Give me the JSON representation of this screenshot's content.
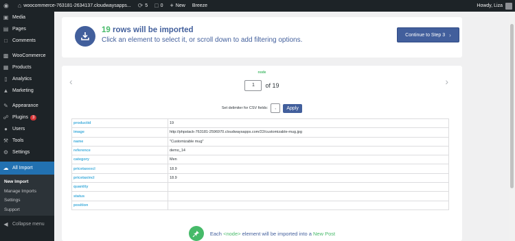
{
  "admin_bar": {
    "site_name": "woocommerce-763181-2634137.cloudwaysapps...",
    "updates_count": "5",
    "comments_count": "0",
    "new_label": "New",
    "breeze_label": "Breeze",
    "howdy_text": "Howdy, Liza"
  },
  "sidebar": {
    "items": [
      {
        "label": "Media",
        "icon": "media-icon"
      },
      {
        "label": "Pages",
        "icon": "pages-icon"
      },
      {
        "label": "Comments",
        "icon": "comments-icon"
      },
      {
        "label": "WooCommerce",
        "icon": "woocommerce-icon"
      },
      {
        "label": "Products",
        "icon": "products-icon"
      },
      {
        "label": "Analytics",
        "icon": "analytics-icon"
      },
      {
        "label": "Marketing",
        "icon": "marketing-icon"
      },
      {
        "label": "Appearance",
        "icon": "appearance-icon"
      },
      {
        "label": "Plugins",
        "icon": "plugins-icon",
        "badge": "3"
      },
      {
        "label": "Users",
        "icon": "users-icon"
      },
      {
        "label": "Tools",
        "icon": "tools-icon"
      },
      {
        "label": "Settings",
        "icon": "settings-icon"
      },
      {
        "label": "All Import",
        "icon": "all-import-icon"
      }
    ],
    "submenu": [
      "New Import",
      "Manage Imports",
      "Settings",
      "Support"
    ],
    "collapse_label": "Collapse menu"
  },
  "top_panel": {
    "rows_count": "19",
    "rows_text": "rows will be imported",
    "subtitle": "Click an element to select it, or scroll down to add filtering options.",
    "continue_label": "Continue to Step 3"
  },
  "main_panel": {
    "node_title": "node",
    "page_value": "1",
    "page_total": "of 19",
    "delimiter_label": "Set delimiter for CSV fields:",
    "delimiter_value": ",",
    "apply_label": "Apply",
    "rows": [
      {
        "key": "productid",
        "value": "19"
      },
      {
        "key": "image",
        "value": "http://phpstack-763181-2596970.cloudwaysapps.com/22/customizable-mug.jpg"
      },
      {
        "key": "name",
        "value": "\"Customizable mug\""
      },
      {
        "key": "reference",
        "value": "demo_14"
      },
      {
        "key": "category",
        "value": "Men"
      },
      {
        "key": "pricetaxexcl",
        "value": "18.9"
      },
      {
        "key": "pricetaxincl",
        "value": "18.9"
      },
      {
        "key": "quantity",
        "value": ""
      },
      {
        "key": "status",
        "value": ""
      },
      {
        "key": "position",
        "value": ""
      }
    ],
    "footer": {
      "prefix": "Each",
      "node_tag": "<node>",
      "middle": "element will be imported into a",
      "post_type": "New Post"
    }
  },
  "colors": {
    "admin_dark": "#1d2327",
    "accent_blue": "#425f9c",
    "active_menu": "#2271b1",
    "green": "#46ba69",
    "key_blue": "#40acdb"
  }
}
